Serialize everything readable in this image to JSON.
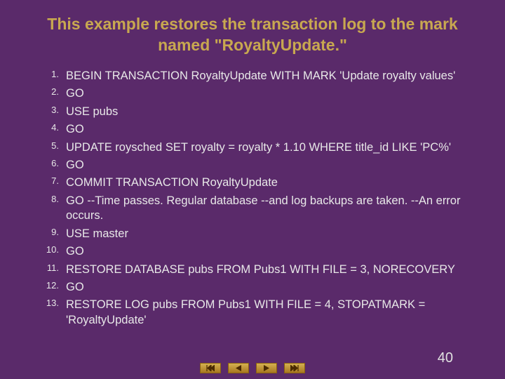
{
  "title": "This example restores the transaction log to the mark named \"RoyaltyUpdate.\"",
  "items": [
    "BEGIN TRANSACTION RoyaltyUpdate WITH MARK 'Update royalty values'",
    "GO",
    "USE pubs",
    "GO",
    "UPDATE roysched SET royalty = royalty * 1.10 WHERE title_id LIKE 'PC%'",
    "GO",
    "COMMIT TRANSACTION RoyaltyUpdate",
    "GO --Time passes. Regular database --and log backups are taken.  --An error occurs.",
    "USE master",
    "GO",
    "RESTORE DATABASE pubs FROM Pubs1 WITH FILE = 3, NORECOVERY",
    "GO",
    "RESTORE LOG pubs FROM Pubs1 WITH FILE = 4, STOPATMARK = 'RoyaltyUpdate'"
  ],
  "page_number": "40"
}
